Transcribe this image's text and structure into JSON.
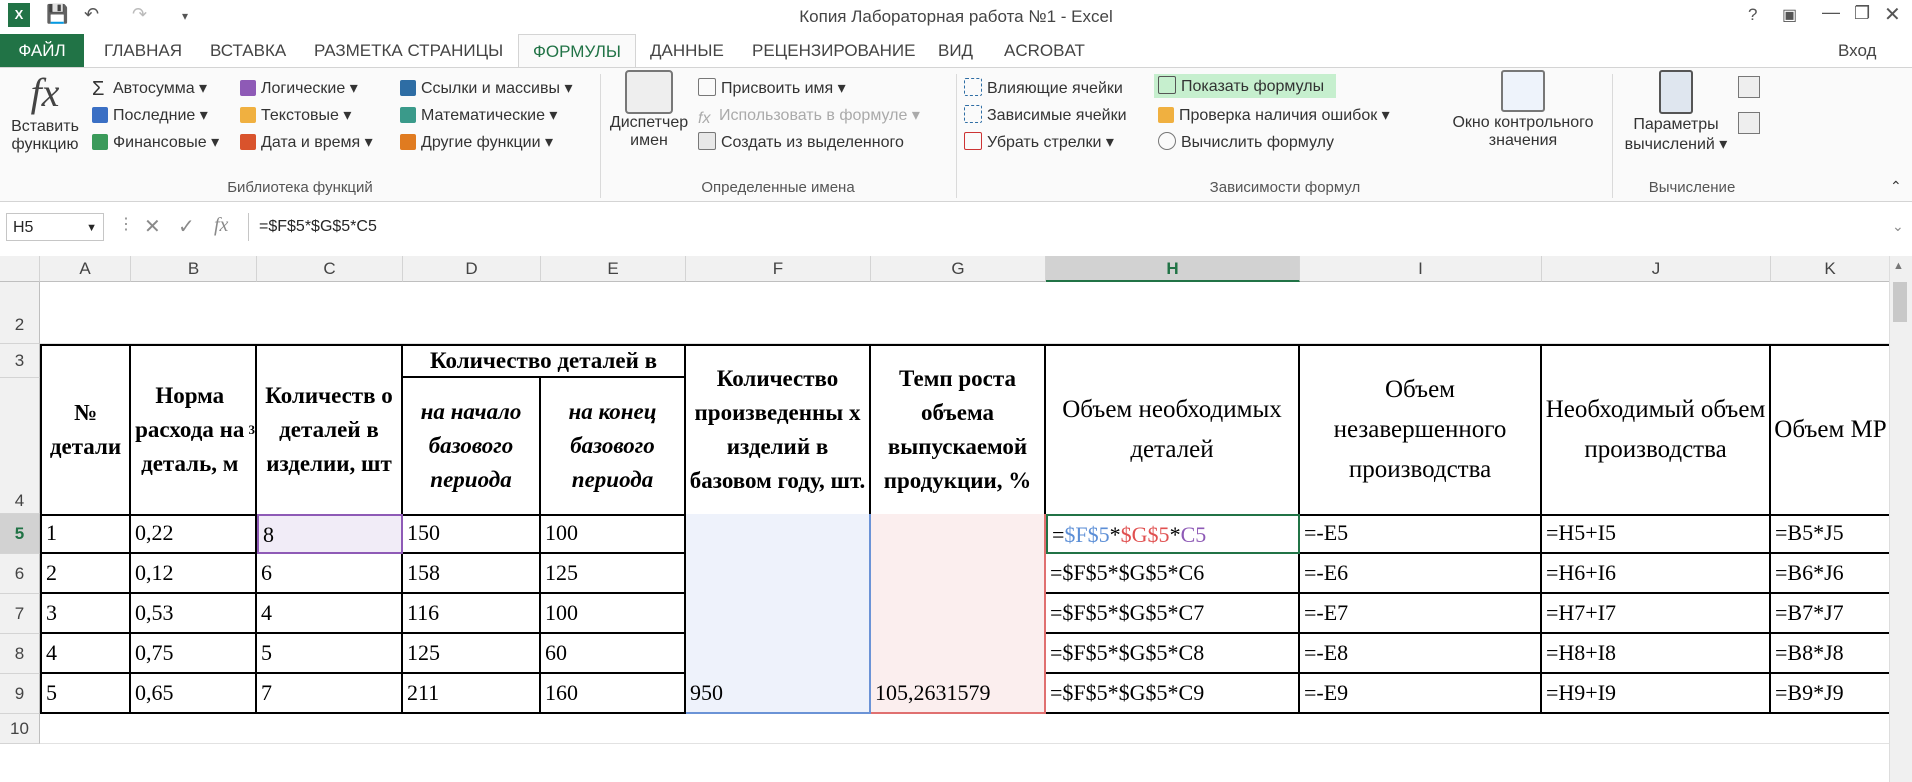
{
  "app": {
    "title": "Копия Лабораторная работа №1 - Excel",
    "help": "?",
    "signin": "Вход"
  },
  "tabs": [
    "ФАЙЛ",
    "ГЛАВНАЯ",
    "ВСТАВКА",
    "РАЗМЕТКА СТРАНИЦЫ",
    "ФОРМУЛЫ",
    "ДАННЫЕ",
    "РЕЦЕНЗИРОВАНИЕ",
    "ВИД",
    "ACROBAT"
  ],
  "ribbon": {
    "insert_function": [
      "Вставить",
      "функцию"
    ],
    "lib": {
      "autosum": "Автосумма",
      "recent": "Последние",
      "financial": "Финансовые",
      "logical": "Логические",
      "text": "Текстовые",
      "datetime": "Дата и время",
      "lookup": "Ссылки и массивы",
      "math": "Математические",
      "other": "Другие функции",
      "group": "Библиотека функций"
    },
    "names": {
      "manager": [
        "Диспетчер",
        "имен"
      ],
      "define": "Присвоить имя",
      "use": "Использовать в формуле",
      "create": "Создать из выделенного",
      "group": "Определенные имена"
    },
    "audit": {
      "precedents": "Влияющие ячейки",
      "dependents": "Зависимые ячейки",
      "remove": "Убрать стрелки",
      "show": "Показать формулы",
      "errors": "Проверка наличия ошибок",
      "evaluate": "Вычислить формулу",
      "watch": [
        "Окно контрольного",
        "значения"
      ],
      "group": "Зависимости формул"
    },
    "calc": {
      "options": [
        "Параметры",
        "вычислений"
      ],
      "group": "Вычисление"
    }
  },
  "formula_bar": {
    "name_box": "H5",
    "fx": "fx",
    "formula": "=$F$5*$G$5*C5"
  },
  "columns": [
    "A",
    "B",
    "C",
    "D",
    "E",
    "F",
    "G",
    "H",
    "I",
    "J",
    "K"
  ],
  "rows": [
    "2",
    "3",
    "4",
    "5",
    "6",
    "7",
    "8",
    "9",
    "10"
  ],
  "headers": {
    "a": "№ детали",
    "b": "Норма расхода на деталь, м",
    "b_sup": "3",
    "c": "Количеств о деталей в изделии, шт",
    "de": "Количество деталей в",
    "d": "на начало базового периода",
    "e": "на конец базового периода",
    "f": "Количество произведенны х изделий в базовом году, шт.",
    "g": "Темп роста объема выпускаемой продукции, %",
    "h": "Объем необходимых деталей",
    "i": "Объем незавершенного производства",
    "j": "Необходимый объем производства",
    "k": "Объем МР"
  },
  "h5_parts": [
    "=",
    "$F$5",
    "*",
    "$G$5",
    "*",
    "C5"
  ],
  "h5_colors": [
    "#000000",
    "#5b8ed6",
    "#000000",
    "#e05050",
    "#000000",
    "#8e5ab6"
  ],
  "data": [
    {
      "a": "1",
      "b": "0,22",
      "c": "8",
      "d": "150",
      "e": "100",
      "f": "",
      "g": "",
      "h": "",
      "i": "=-E5",
      "j": "=H5+I5",
      "k": "=B5*J5"
    },
    {
      "a": "2",
      "b": "0,12",
      "c": "6",
      "d": "158",
      "e": "125",
      "f": "",
      "g": "",
      "h": "=$F$5*$G$5*C6",
      "i": "=-E6",
      "j": "=H6+I6",
      "k": "=B6*J6"
    },
    {
      "a": "3",
      "b": "0,53",
      "c": "4",
      "d": "116",
      "e": "100",
      "f": "",
      "g": "",
      "h": "=$F$5*$G$5*C7",
      "i": "=-E7",
      "j": "=H7+I7",
      "k": "=B7*J7"
    },
    {
      "a": "4",
      "b": "0,75",
      "c": "5",
      "d": "125",
      "e": "60",
      "f": "",
      "g": "",
      "h": "=$F$5*$G$5*C8",
      "i": "=-E8",
      "j": "=H8+I8",
      "k": "=B8*J8"
    },
    {
      "a": "5",
      "b": "0,65",
      "c": "7",
      "d": "211",
      "e": "160",
      "f": "950",
      "g": "105,2631579",
      "h": "=$F$5*$G$5*C9",
      "i": "=-E9",
      "j": "=H9+I9",
      "k": "=B9*J9"
    }
  ]
}
